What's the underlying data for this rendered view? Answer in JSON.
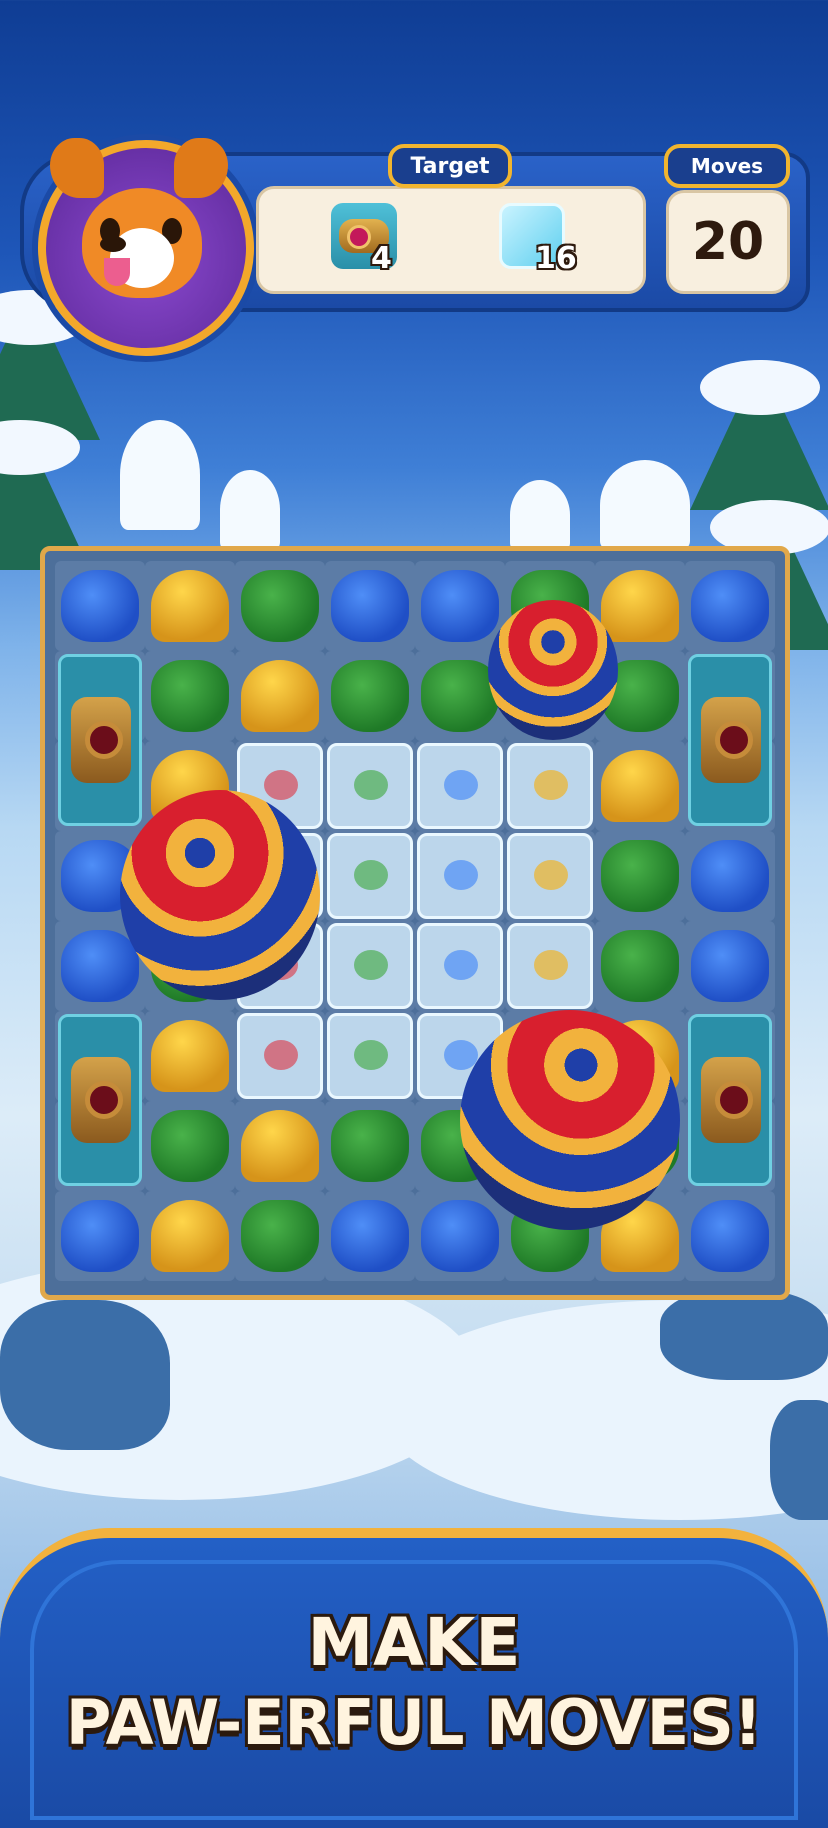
{
  "hud": {
    "target_label": "Target",
    "moves_label": "Moves",
    "moves_value": "20",
    "goals": [
      {
        "icon": "cannon-icon",
        "count": "4"
      },
      {
        "icon": "ice-block-icon",
        "count": "16"
      }
    ]
  },
  "board": {
    "rows": [
      [
        "blue",
        "yellow",
        "green",
        "blue",
        "blue",
        "green",
        "yellow",
        "blue"
      ],
      [
        "cannon",
        "green",
        "yellow",
        "green",
        "green",
        "blue",
        "green",
        "cannon"
      ],
      [
        "cannon",
        "yellow",
        "ice",
        "ice",
        "ice",
        "ice",
        "yellow",
        "cannon"
      ],
      [
        "blue",
        "yellow",
        "ice",
        "ice",
        "ice",
        "ice",
        "green",
        "blue"
      ],
      [
        "blue",
        "green",
        "ice",
        "ice",
        "ice",
        "ice",
        "green",
        "blue"
      ],
      [
        "cannon",
        "yellow",
        "ice",
        "ice",
        "ice",
        "yellow",
        "yellow",
        "cannon"
      ],
      [
        "cannon",
        "green",
        "yellow",
        "green",
        "green",
        "green",
        "green",
        "cannon"
      ],
      [
        "blue",
        "yellow",
        "green",
        "blue",
        "blue",
        "green",
        "yellow",
        "blue"
      ]
    ]
  },
  "banner": {
    "line1": "MAKE",
    "line2": "PAW-ERFUL MOVES!"
  },
  "colors": {
    "accent_gold": "#f1b52f",
    "hud_blue": "#1b4aa6",
    "piece_blue": "#2a5fd6",
    "piece_green": "#2f9436",
    "piece_yellow": "#f0b328"
  }
}
